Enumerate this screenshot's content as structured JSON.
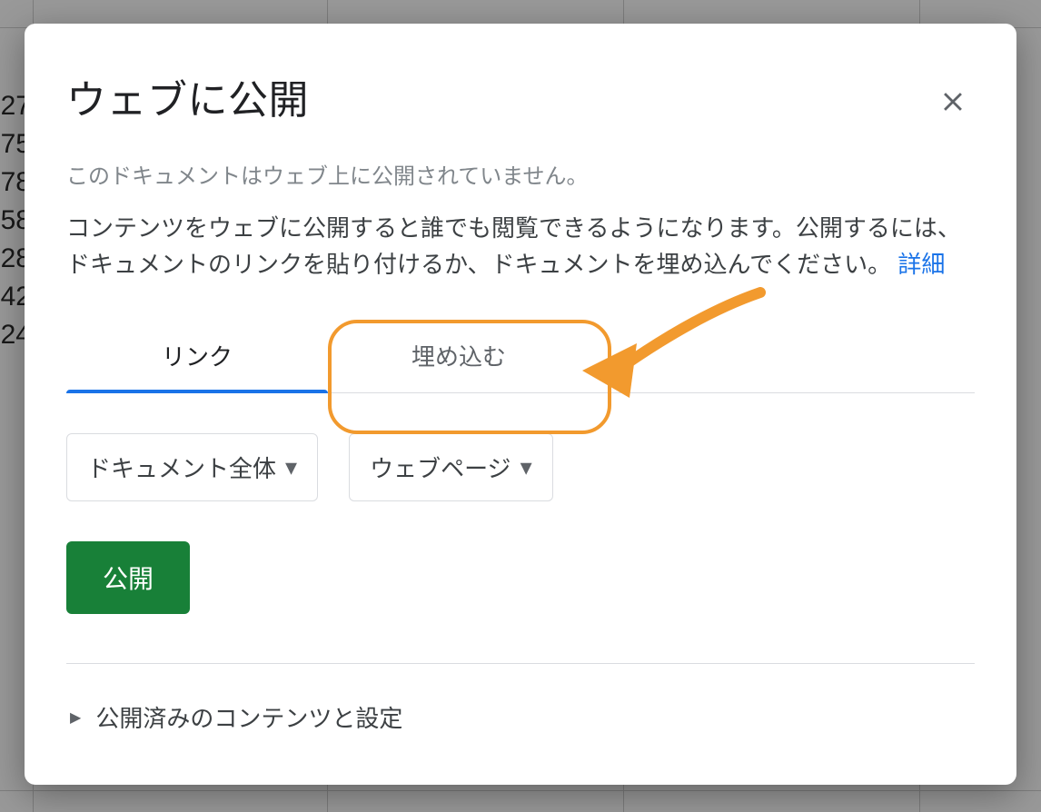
{
  "background": {
    "row_numbers": [
      "27",
      "75",
      "78",
      "58",
      "28",
      "42",
      "24"
    ]
  },
  "dialog": {
    "title": "ウェブに公開",
    "status": "このドキュメントはウェブ上に公開されていません。",
    "description_pre": "コンテンツをウェブに公開すると誰でも閲覧できるようになります。公開するには、ドキュメントのリンクを貼り付けるか、ドキュメントを埋め込んでください。",
    "learn_more": "詳細",
    "tabs": {
      "link": "リンク",
      "embed": "埋め込む"
    },
    "selects": {
      "scope": "ドキュメント全体",
      "format": "ウェブページ"
    },
    "publish_button": "公開",
    "expander_label": "公開済みのコンテンツと設定"
  }
}
